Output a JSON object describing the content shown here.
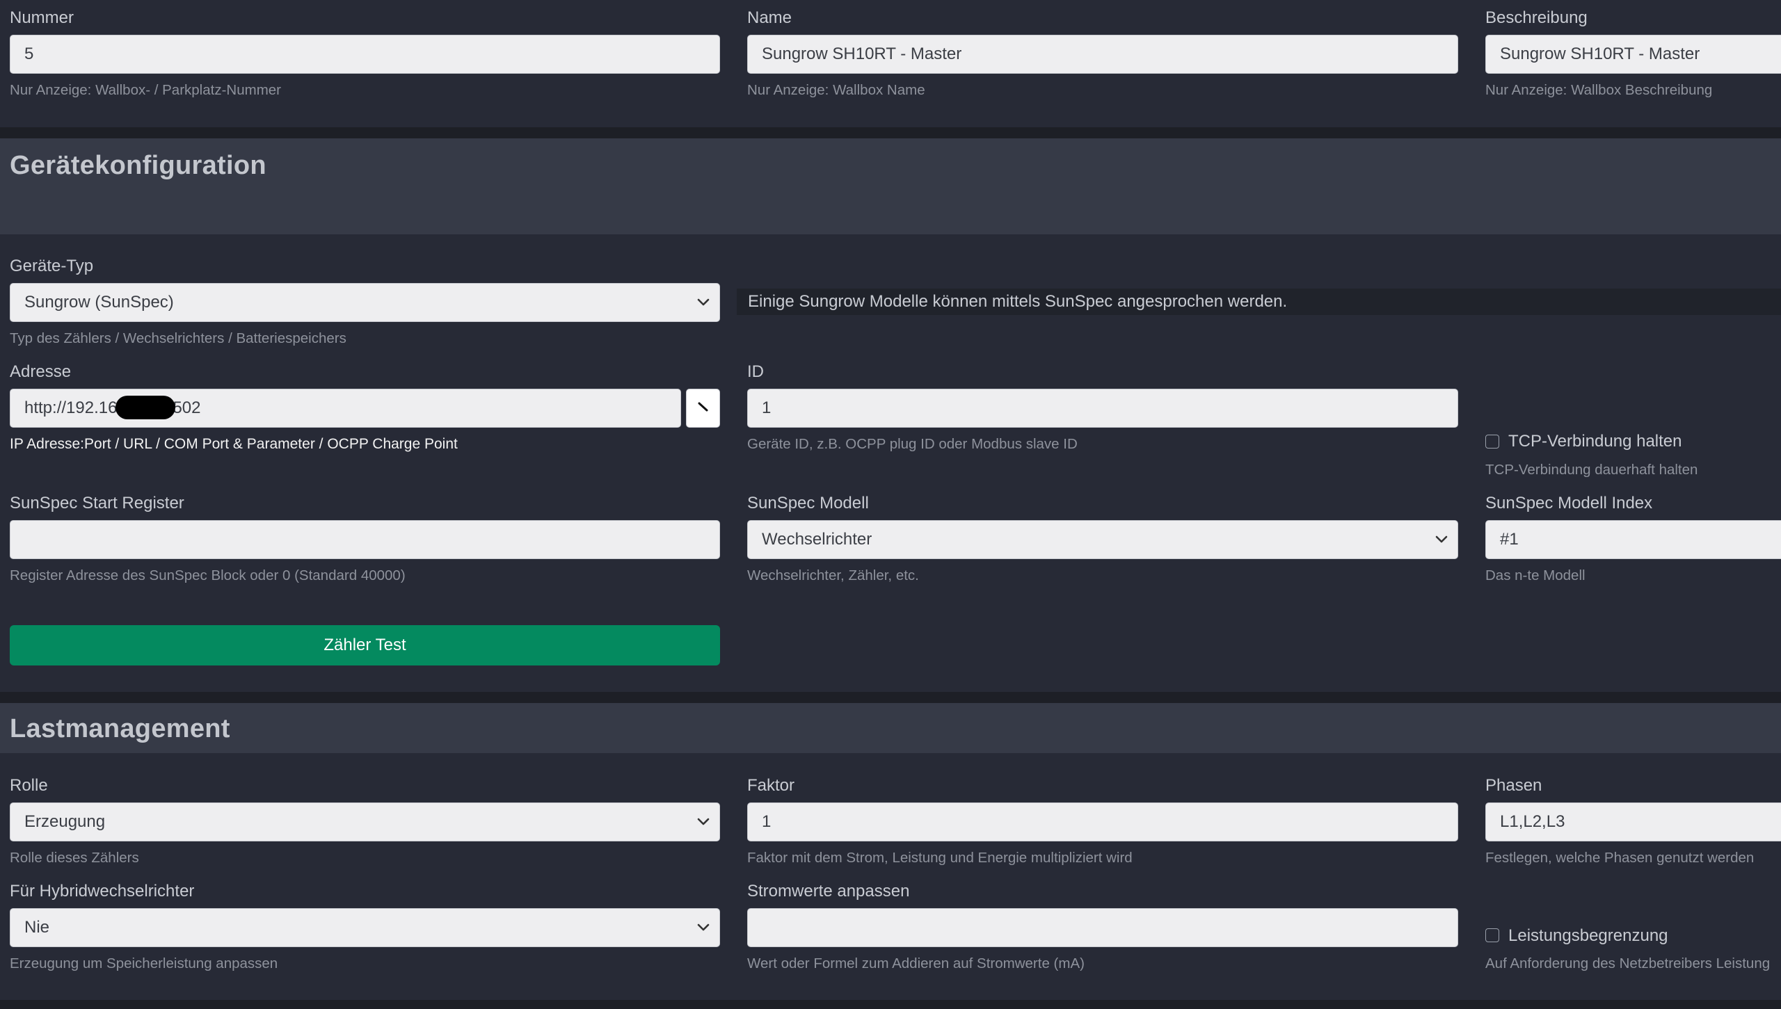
{
  "top": {
    "nummer": {
      "label": "Nummer",
      "value": "5",
      "hint": "Nur Anzeige: Wallbox- / Parkplatz-Nummer"
    },
    "name": {
      "label": "Name",
      "value": "Sungrow SH10RT - Master",
      "hint": "Nur Anzeige: Wallbox Name"
    },
    "beschreibung": {
      "label": "Beschreibung",
      "value": "Sungrow SH10RT - Master",
      "hint": "Nur Anzeige: Wallbox Beschreibung"
    }
  },
  "geraet": {
    "title": "Gerätekonfiguration",
    "typ": {
      "label": "Geräte-Typ",
      "value": "Sungrow (SunSpec)",
      "hint": "Typ des Zählers / Wechselrichters / Batteriespeichers"
    },
    "info": "Einige Sungrow Modelle können mittels SunSpec angesprochen werden.",
    "adresse": {
      "label": "Adresse",
      "value_start": "http://192.16",
      "value_end": "502",
      "hint": "IP Adresse:Port / URL / COM Port & Parameter / OCPP Charge Point"
    },
    "id": {
      "label": "ID",
      "value": "1",
      "hint": "Geräte ID, z.B. OCPP plug ID oder Modbus slave ID"
    },
    "tcp": {
      "label": "TCP-Verbindung halten",
      "hint": "TCP-Verbindung dauerhaft halten"
    },
    "start_register": {
      "label": "SunSpec Start Register",
      "value": "",
      "hint": "Register Adresse des SunSpec Block oder 0 (Standard 40000)"
    },
    "modell": {
      "label": "SunSpec Modell",
      "value": "Wechselrichter",
      "hint": "Wechselrichter, Zähler, etc."
    },
    "modell_index": {
      "label": "SunSpec Modell Index",
      "value": "#1",
      "hint": "Das n-te Modell"
    },
    "test_button": "Zähler Test"
  },
  "last": {
    "title": "Lastmanagement",
    "rolle": {
      "label": "Rolle",
      "value": "Erzeugung",
      "hint": "Rolle dieses Zählers"
    },
    "faktor": {
      "label": "Faktor",
      "value": "1",
      "hint": "Faktor mit dem Strom, Leistung und Energie multipliziert wird"
    },
    "phasen": {
      "label": "Phasen",
      "value": "L1,L2,L3",
      "hint": "Festlegen, welche Phasen genutzt werden"
    },
    "hybrid": {
      "label": "Für Hybridwechselrichter",
      "value": "Nie",
      "hint": "Erzeugung um Speicherleistung anpassen"
    },
    "strom": {
      "label": "Stromwerte anpassen",
      "value": "",
      "hint": "Wert oder Formel zum Addieren auf Stromwerte (mA)"
    },
    "leistung": {
      "label": "Leistungsbegrenzung",
      "hint": "Auf Anforderung des Netzbetreibers Leistung"
    }
  },
  "colors": {
    "background": "#272a36",
    "section": "#363a47",
    "accent_button": "#048a5f",
    "input": "#eeeef0"
  }
}
